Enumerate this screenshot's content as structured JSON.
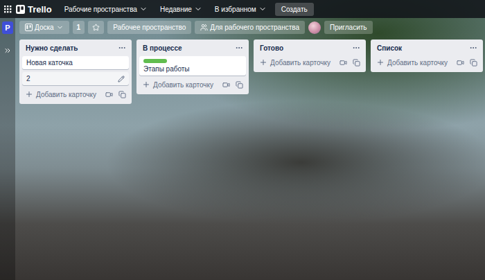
{
  "nav": {
    "logo": "Trello",
    "menus": [
      {
        "label": "Рабочие пространства"
      },
      {
        "label": "Недавние"
      },
      {
        "label": "В избранном"
      }
    ],
    "create": "Создать"
  },
  "board_bar": {
    "workspace_avatar": "P",
    "view": "Доска",
    "count": "1",
    "starred": false,
    "visibility": "Рабочее пространство",
    "share_scope": "Для рабочего пространства",
    "invite": "Пригласить"
  },
  "lists": [
    {
      "title": "Нужно сделать",
      "cards": [
        {
          "text": "Новая каточка",
          "labels": [],
          "hovered": false
        },
        {
          "text": "2",
          "labels": [],
          "hovered": true
        }
      ],
      "add": "Добавить карточку"
    },
    {
      "title": "В процессе",
      "cards": [
        {
          "text": "Этапы работы",
          "labels": [
            {
              "color": "#61bd4f"
            }
          ],
          "hovered": false
        }
      ],
      "add": "Добавить карточку"
    },
    {
      "title": "Готово",
      "cards": [],
      "add": "Добавить карточку"
    },
    {
      "title": "Список",
      "cards": [],
      "add": "Добавить карточку"
    }
  ]
}
